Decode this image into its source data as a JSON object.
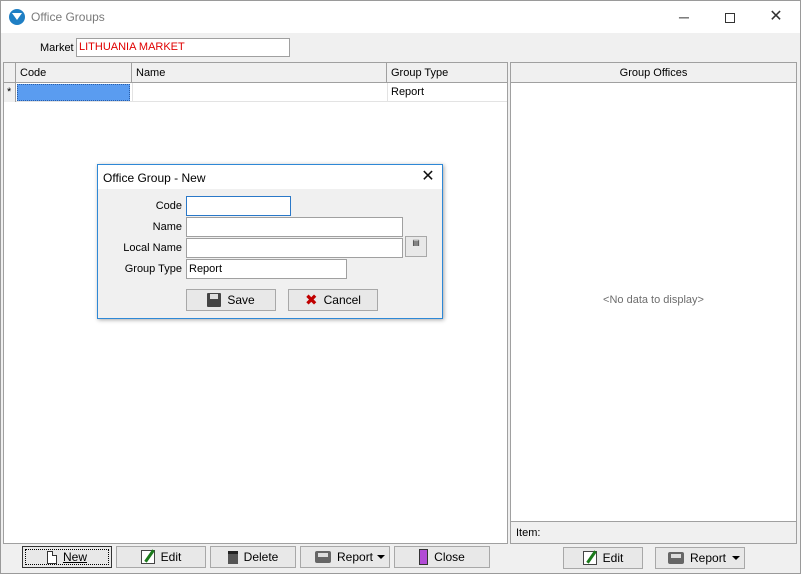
{
  "window": {
    "title": "Office Groups",
    "controls": {
      "minimize": "─",
      "close": "✕"
    }
  },
  "market": {
    "label": "Market",
    "value": "LITHUANIA MARKET",
    "value_color": "#e00000"
  },
  "groups_grid": {
    "columns": [
      "Code",
      "Name",
      "Group Type"
    ],
    "new_row": {
      "indicator": "*",
      "code": "",
      "name": "",
      "group_type": "Report"
    }
  },
  "group_offices": {
    "header": "Group Offices",
    "empty_text": "<No data to display>",
    "item_label": "Item:"
  },
  "left_toolbar": {
    "new": {
      "label": "New",
      "icon": "new-document-icon"
    },
    "edit": {
      "label": "Edit",
      "icon": "edit-icon"
    },
    "delete": {
      "label": "Delete",
      "icon": "trash-icon"
    },
    "report": {
      "label": "Report",
      "icon": "printer-icon"
    },
    "close": {
      "label": "Close",
      "icon": "door-icon"
    }
  },
  "right_toolbar": {
    "edit": {
      "label": "Edit",
      "icon": "edit-icon"
    },
    "report": {
      "label": "Report",
      "icon": "printer-icon"
    }
  },
  "dialog": {
    "title": "Office Group - New",
    "close_glyph": "✕",
    "fields": {
      "code": {
        "label": "Code",
        "value": ""
      },
      "name": {
        "label": "Name",
        "value": ""
      },
      "local_name": {
        "label": "Local Name",
        "value": ""
      },
      "group_type": {
        "label": "Group Type",
        "value": "Report"
      }
    },
    "save_label": "Save",
    "cancel_label": "Cancel",
    "cancel_glyph": "✖"
  },
  "colors": {
    "selection": "#5a9cf0",
    "dialog_border": "#2e88d6",
    "market_text": "#e00000"
  }
}
